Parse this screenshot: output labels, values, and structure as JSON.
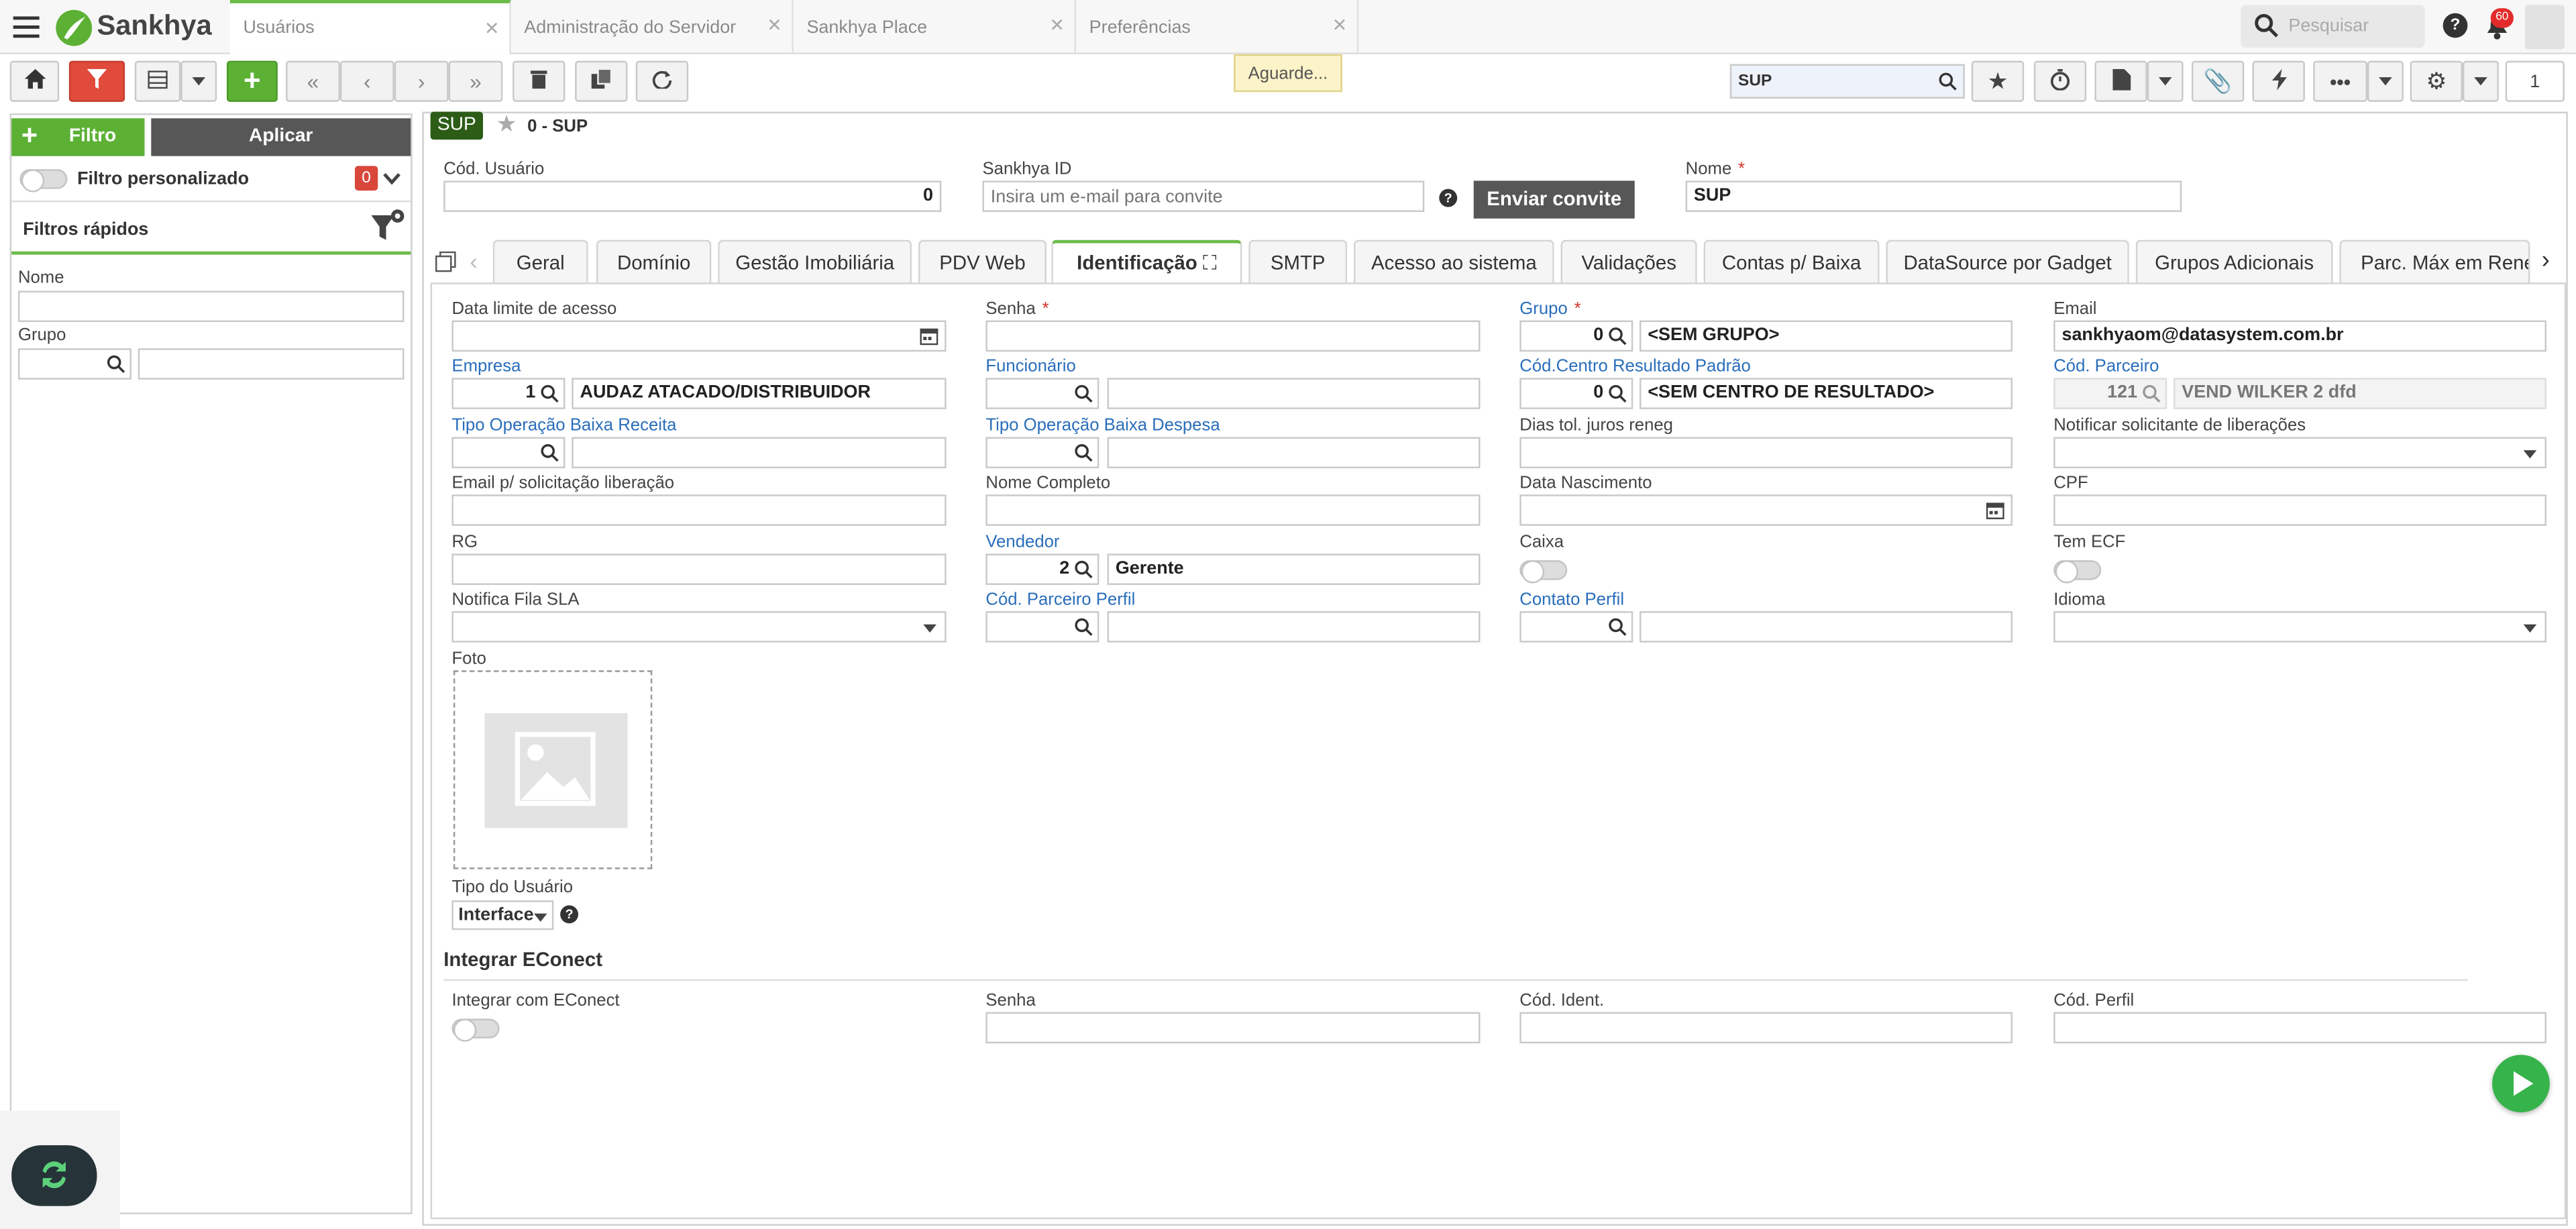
{
  "app": {
    "brand": "Sankhya"
  },
  "tabs": [
    {
      "label": "Usuários"
    },
    {
      "label": "Administração do Servidor"
    },
    {
      "label": "Sankhya Place"
    },
    {
      "label": "Preferências"
    }
  ],
  "header": {
    "search_placeholder": "Pesquisar",
    "notifications": "60"
  },
  "toolbar": {
    "loading": "Aguarde...",
    "quick_search": "SUP",
    "page": "1"
  },
  "sidebar": {
    "filter_button": "Filtro",
    "apply_button": "Aplicar",
    "custom_filter": "Filtro personalizado",
    "custom_filter_count": "0",
    "quick_filters": "Filtros rápidos",
    "name_label": "Nome",
    "group_label": "Grupo"
  },
  "record": {
    "badge": "SUP",
    "title": "0 - SUP"
  },
  "top_fields": {
    "cod_usuario_label": "Cód. Usuário",
    "cod_usuario": "0",
    "sankhya_id_label": "Sankhya ID",
    "sankhya_id_placeholder": "Insira um e-mail para convite",
    "invite_button": "Enviar convite",
    "nome_label": "Nome",
    "nome": "SUP"
  },
  "form_tabs": [
    "Geral",
    "Domínio",
    "Gestão Imobiliária",
    "PDV Web",
    "Identificação",
    "SMTP",
    "Acesso ao sistema",
    "Validações",
    "Contas p/ Baixa",
    "DataSource por Gadget",
    "Grupos Adicionais",
    "Parc. Máx em Rene"
  ],
  "fields": {
    "data_limite": "Data limite de acesso",
    "senha": "Senha",
    "grupo": "Grupo",
    "grupo_code": "0",
    "grupo_name": "<SEM GRUPO>",
    "email": "Email",
    "email_value": "sankhyaom@datasystem.com.br",
    "empresa": "Empresa",
    "empresa_code": "1",
    "empresa_name": "AUDAZ ATACADO/DISTRIBUIDOR",
    "funcionario": "Funcionário",
    "centro": "Cód.Centro Resultado Padrão",
    "centro_code": "0",
    "centro_name": "<SEM CENTRO DE RESULTADO>",
    "parceiro": "Cód. Parceiro",
    "parceiro_code": "121",
    "parceiro_name": "VEND WILKER 2 dfd",
    "top_receita": "Tipo Operação Baixa Receita",
    "top_despesa": "Tipo Operação Baixa Despesa",
    "dias_tol": "Dias tol. juros reneg",
    "notificar": "Notificar solicitante de liberações",
    "email_lib": "Email p/ solicitação liberação",
    "nome_completo": "Nome Completo",
    "data_nasc": "Data Nascimento",
    "cpf": "CPF",
    "rg": "RG",
    "vendedor": "Vendedor",
    "vendedor_code": "2",
    "vendedor_name": "Gerente",
    "caixa": "Caixa",
    "tem_ecf": "Tem ECF",
    "notifica_sla": "Notifica Fila SLA",
    "parceiro_perfil": "Cód. Parceiro Perfil",
    "contato_perfil": "Contato Perfil",
    "idioma": "Idioma",
    "foto": "Foto",
    "tipo_usuario": "Tipo do Usuário",
    "tipo_usuario_value": "Interface"
  },
  "econect": {
    "section": "Integrar EConect",
    "integrar": "Integrar com EConect",
    "senha": "Senha",
    "cod_ident": "Cód. Ident.",
    "cod_perfil": "Cód. Perfil"
  }
}
